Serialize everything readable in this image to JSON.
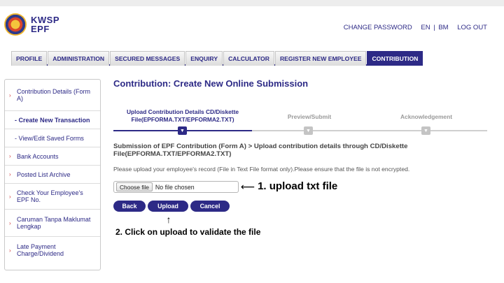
{
  "brand": {
    "line1": "KWSP",
    "line2": "EPF"
  },
  "top_links": {
    "change_password": "CHANGE PASSWORD",
    "en": "EN",
    "separator": "|",
    "bm": "BM",
    "logout": "LOG OUT"
  },
  "nav": {
    "tabs": [
      {
        "label": "PROFILE",
        "active": false
      },
      {
        "label": "ADMINISTRATION",
        "active": false
      },
      {
        "label": "SECURED MESSAGES",
        "active": false
      },
      {
        "label": "ENQUIRY",
        "active": false
      },
      {
        "label": "CALCULATOR",
        "active": false
      },
      {
        "label": "REGISTER NEW EMPLOYEE",
        "active": false
      },
      {
        "label": "CONTRIBUTION",
        "active": true
      }
    ]
  },
  "sidebar": {
    "items": [
      {
        "label": "Contribution Details (Form A)",
        "arrow": "›"
      },
      {
        "label": "- Create New Transaction",
        "arrow": ""
      },
      {
        "label": "- View/Edit Saved Forms",
        "arrow": ""
      },
      {
        "label": "Bank Accounts",
        "arrow": "›"
      },
      {
        "label": "Posted List Archive",
        "arrow": "›"
      },
      {
        "label": "Check Your Employee's EPF No.",
        "arrow": "›"
      },
      {
        "label": "Caruman Tanpa Maklumat Lengkap",
        "arrow": "›"
      },
      {
        "label": "Late Payment Charge/Dividend",
        "arrow": "›"
      }
    ]
  },
  "main": {
    "title": "Contribution: Create New Online Submission",
    "steps": [
      {
        "label": "Upload Contribution Details CD/Diskette File(EPFORMA.TXT/EPFORMA2.TXT)",
        "active": true
      },
      {
        "label": "Preview/Submit",
        "active": false
      },
      {
        "label": "Acknowledgement",
        "active": false
      }
    ],
    "sub_heading": "Submission of EPF Contribution (Form A) > Upload contribution details through CD/Diskette File(EPFORMA.TXT/EPFORMA2.TXT)",
    "instruction": "Please upload your employee's record (File in Text File format only).Please ensure that the file is not encrypted.",
    "file_input": {
      "button": "Choose file",
      "status": "No file chosen"
    },
    "buttons": {
      "back": "Back",
      "upload": "Upload",
      "cancel": "Cancel"
    }
  },
  "annotations": {
    "step1": "1. upload txt file",
    "step2": "2. Click on upload to validate the file",
    "arrow_left": "⟵",
    "arrow_up": "↑"
  },
  "colors": {
    "brand": "#2d2a86",
    "accent_arrow": "#d23a3a"
  }
}
